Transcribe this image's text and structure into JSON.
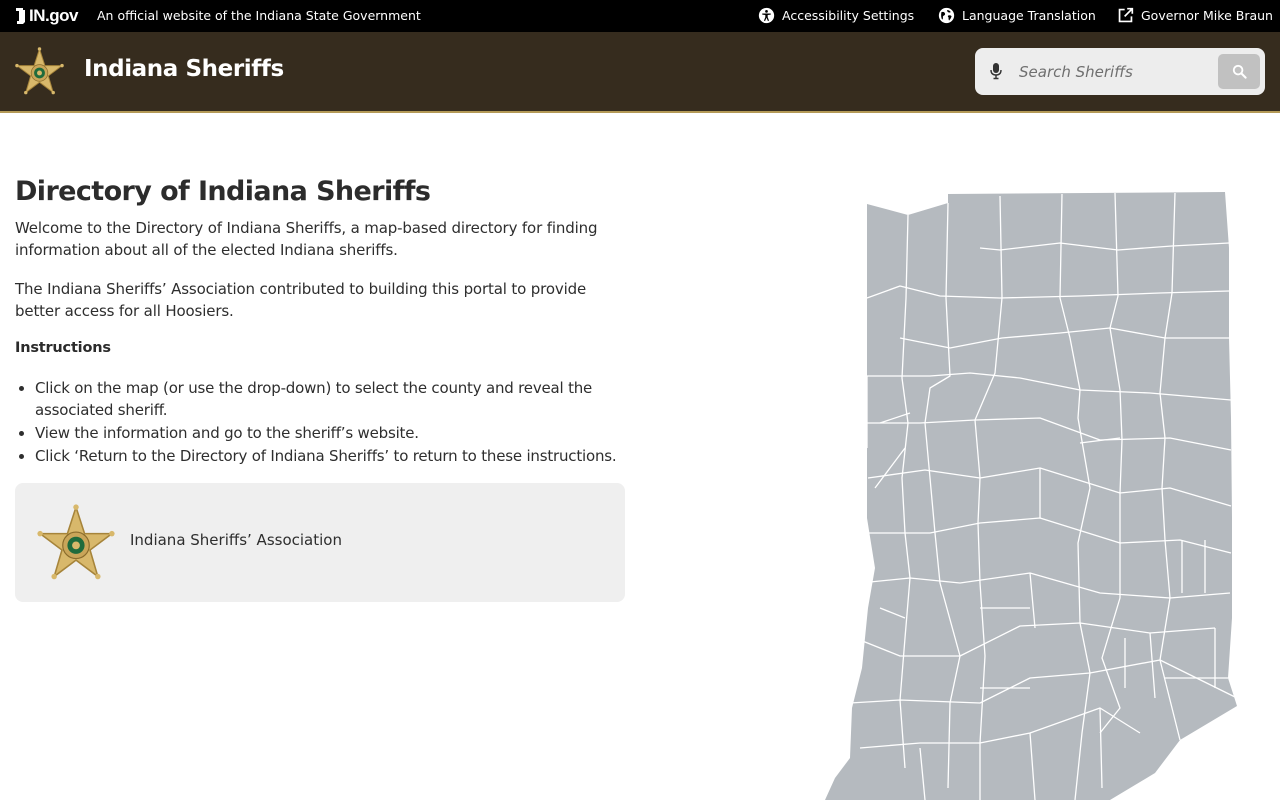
{
  "topbar": {
    "logo_text": "IN.gov",
    "official_text": "An official website of the Indiana State Government",
    "accessibility_label": "Accessibility Settings",
    "language_label": "Language Translation",
    "governor_label": "Governor Mike Braun"
  },
  "header": {
    "title": "Indiana Sheriffs",
    "search_placeholder": "Search Sheriffs"
  },
  "main": {
    "heading": "Directory of Indiana Sheriffs",
    "intro": "Welcome to the Directory of Indiana Sheriffs, a map-based directory for finding information about all of the elected Indiana sheriffs.",
    "contribution": "The Indiana Sheriffs’ Association contributed to building this portal to provide better access for all Hoosiers.",
    "instructions_heading": "Instructions",
    "instructions": [
      "Click on the map (or use the drop-down) to select the county and reveal the associated sheriff.",
      "View the information and go to the sheriff’s website.",
      "Click ‘Return to the Directory of Indiana Sheriffs’ to return to these instructions."
    ],
    "association_name": "Indiana Sheriffs’ Association"
  },
  "colors": {
    "topbar": "#000000",
    "header": "#362c1e",
    "header_rule": "#b49a57",
    "map_fill": "#b5babf",
    "card_bg": "#efefef"
  },
  "icons": {
    "accessibility": "accessibility-icon",
    "language": "globe-icon",
    "governor": "external-link-icon",
    "mic": "microphone-icon",
    "search": "search-icon",
    "badge": "sheriff-star-badge"
  }
}
